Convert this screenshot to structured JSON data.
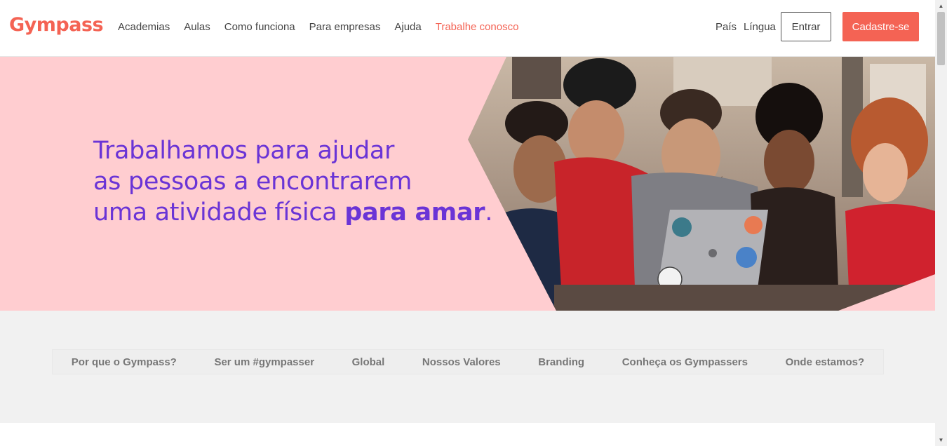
{
  "header": {
    "logo": "Gympass",
    "nav": [
      "Academias",
      "Aulas",
      "Como funciona",
      "Para empresas",
      "Ajuda",
      "Trabalhe conosco"
    ],
    "country": "País",
    "language": "Língua",
    "login": "Entrar",
    "signup": "Cadastre-se"
  },
  "hero": {
    "line1": "Trabalhamos para ajudar",
    "line2": "as pessoas a encontrarem",
    "line3": "uma atividade física ",
    "highlight": "para amar",
    "period": "."
  },
  "tabs": [
    "Por que o Gympass?",
    "Ser um #gympasser",
    "Global",
    "Nossos Valores",
    "Branding",
    "Conheça os Gympassers",
    "Onde estamos?"
  ],
  "colors": {
    "brand": "#f46354",
    "hero_bg": "#ffcdd0",
    "headline": "#6a34d6"
  }
}
